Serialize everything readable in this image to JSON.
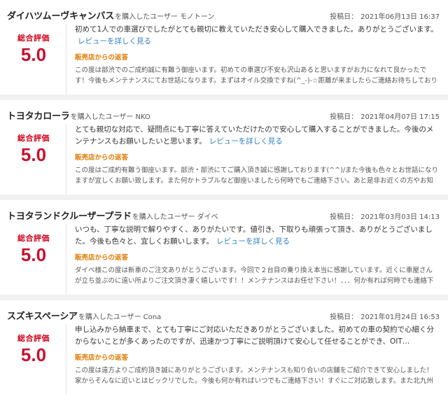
{
  "ui": {
    "buyer_label": "を購入したユーザー",
    "posted_label": "投稿日：",
    "score_label": "総合評価",
    "more_link": "レビューを詳しく見る",
    "shop_reply_label": "販売店からの返答",
    "colors": {
      "score": "#c8102e",
      "link": "#2f7fc1",
      "shop_reply_heading": "#e07b00",
      "separator": "#f1f1f1"
    }
  },
  "reviews": [
    {
      "car": "ダイハツムーヴキャンバス",
      "user": "モノトーン",
      "date": "2021年06月13日 16:37",
      "score": "5.0",
      "comment": "初めて1人での車選びでしたがとても親切に教えていただき安心して購入できました。ありがとうございます。",
      "reply": "この度は部渋でのご成約誠に有難う御座います。初めての車選び不安も沢山あると思いますがお力になれて良かったです！今後もメンテナンスにてお世話になります。まずはオイル交換ですね(^_-)-☆距離が来ましたらご連絡お待ちしております。この度はありがと…"
    },
    {
      "car": "トヨタカローラ",
      "user": "NKO",
      "date": "2021年04月07日 17:15",
      "score": "5.0",
      "comment": "とても親切な対応で、疑問点にも丁寧に答えていただけたので安心して購入することができました。今後のメンテナンスもお願いしたいと思います。",
      "reply": "この度はご成約有難う御座います。部渋・部渋にてご購入頂き誠に感謝しております(^^)/また今後も色々とお世話になりますが宜しくお願い致します。また何かトラブルなど御座いましたら何時でもご連絡下さい。あと是非お近くの方やお知り合いの方のご紹介お待ち…"
    },
    {
      "car": "トヨタランドクルーザープラド",
      "user": "ダイベ",
      "date": "2021年03月03日 14:13",
      "score": "5.0",
      "comment": "いつも、丁寧な説明で解りやすく、ありがたいです。値引き、下取りも頑張って頂き、ありがとうございました。今後も色々と、宜しくお願いします。",
      "reply": "ダイベ様この度は新車のご注文ありがとうございます。今回で２台目の乗り換え本当に感謝しています。近くに車屋さんが立ち並ぶのに遠い所よりご注文頂き凄く嬉しいです！！メンテナンスはお任せ下さい！．．．何か有れば何時でも連絡下さい(^^)/今後も末…"
    },
    {
      "car": "スズキスペーシア",
      "user": "Cona",
      "date": "2021年01月24日 16:53",
      "score": "5.0",
      "comment": "申し込みから納車まで、とても丁寧にご対応いただきありがとうございました。初めての車の契約で心細く分からないことが多くあったのですが、迅速かつ丁寧にご説明頂けて安心して任せることができ、OIT…",
      "reply": "この度は遠方よりご成約頂き誠にありがとうございます。メンテナンスも知り合いの店舗をご紹介できて安心しました！家からそんなに近いとはビックリでした。今後も何か有ればいつでもご連絡下さい！すぐにご対応致します。また北九州でも納車待いますので是非とも…"
    }
  ]
}
